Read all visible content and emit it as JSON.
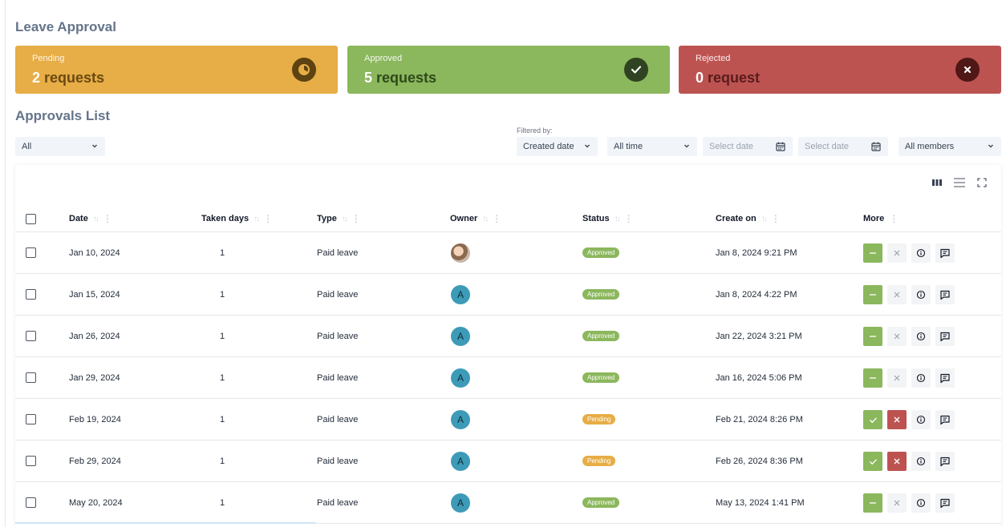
{
  "page": {
    "title": "Leave Approval"
  },
  "summary": {
    "pending": {
      "label": "Pending",
      "count": "2",
      "unit": "requests",
      "color": "#e7ad46",
      "icon": "clock-icon"
    },
    "approved": {
      "label": "Approved",
      "count": "5",
      "unit": "requests",
      "color": "#8bb75d",
      "icon": "check-icon"
    },
    "rejected": {
      "label": "Rejected",
      "count": "0",
      "unit": "request",
      "color": "#bd5351",
      "icon": "close-icon"
    }
  },
  "approvals": {
    "title": "Approvals List",
    "filtered_by_label": "Filtered by:",
    "filters": {
      "type": "All",
      "date_field": "Created date",
      "period": "All time",
      "start_date_placeholder": "Select date",
      "end_date_placeholder": "Select date",
      "members": "All members"
    },
    "columns": {
      "date": "Date",
      "taken_days": "Taken days",
      "type": "Type",
      "owner": "Owner",
      "status": "Status",
      "created_on": "Create on",
      "more": "More"
    },
    "rows": [
      {
        "date": "Jan 10, 2024",
        "days": "1",
        "type": "Paid leave",
        "owner_initial": "",
        "status": "Approved",
        "created": "Jan 8, 2024 9:21 PM"
      },
      {
        "date": "Jan 15, 2024",
        "days": "1",
        "type": "Paid leave",
        "owner_initial": "A",
        "status": "Approved",
        "created": "Jan 8, 2024 4:22 PM"
      },
      {
        "date": "Jan 26, 2024",
        "days": "1",
        "type": "Paid leave",
        "owner_initial": "A",
        "status": "Approved",
        "created": "Jan 22, 2024 3:21 PM"
      },
      {
        "date": "Jan 29, 2024",
        "days": "1",
        "type": "Paid leave",
        "owner_initial": "A",
        "status": "Approved",
        "created": "Jan 16, 2024 5:06 PM"
      },
      {
        "date": "Feb 19, 2024",
        "days": "1",
        "type": "Paid leave",
        "owner_initial": "A",
        "status": "Pending",
        "created": "Feb 21, 2024 8:26 PM"
      },
      {
        "date": "Feb 29, 2024",
        "days": "1",
        "type": "Paid leave",
        "owner_initial": "A",
        "status": "Pending",
        "created": "Feb 26, 2024 8:36 PM"
      },
      {
        "date": "May 20, 2024",
        "days": "1",
        "type": "Paid leave",
        "owner_initial": "A",
        "status": "Approved",
        "created": "May 13, 2024 1:41 PM"
      }
    ]
  }
}
